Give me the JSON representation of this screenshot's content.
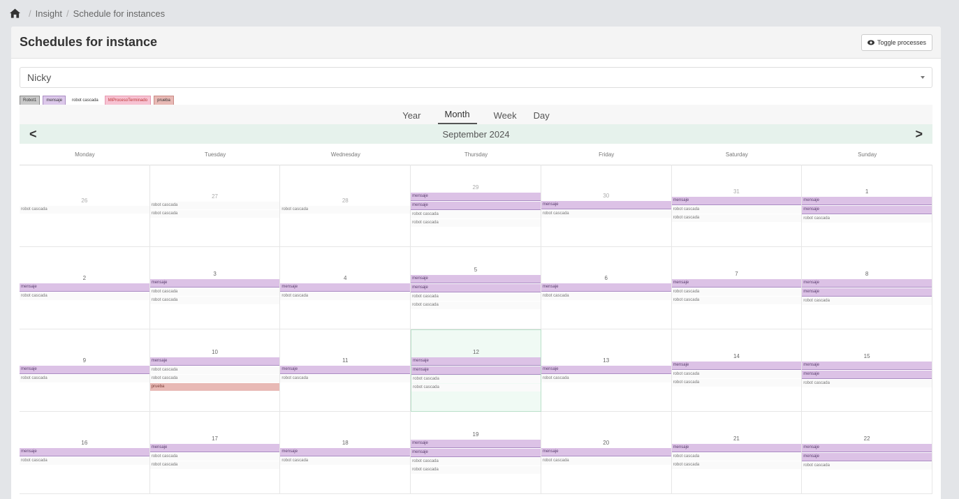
{
  "breadcrumb": {
    "items": [
      "Insight",
      "Schedule for instances"
    ],
    "separator": "/"
  },
  "panel": {
    "title": "Schedules for instance",
    "toggle_label": "Toggle processes"
  },
  "select": {
    "value": "Nicky"
  },
  "legend": [
    "Robot1",
    "mensaje",
    "robot cascada",
    "MiProcesoTerminado",
    "prueba"
  ],
  "views": [
    "Year",
    "Month",
    "Week",
    "Day"
  ],
  "active_view": "Month",
  "month_label": "September 2024",
  "nav": {
    "prev": "<",
    "next": ">"
  },
  "weekdays": [
    "Monday",
    "Tuesday",
    "Wednesday",
    "Thursday",
    "Friday",
    "Saturday",
    "Sunday"
  ],
  "days": [
    {
      "num": "26",
      "current": false,
      "events": [
        "robot cascada"
      ]
    },
    {
      "num": "27",
      "current": false,
      "events": [
        "robot cascada",
        "robot cascada"
      ]
    },
    {
      "num": "28",
      "current": false,
      "events": [
        "robot cascada"
      ]
    },
    {
      "num": "29",
      "current": false,
      "events": [
        "mensaje",
        "mensaje",
        "robot cascada",
        "robot cascada"
      ]
    },
    {
      "num": "30",
      "current": false,
      "events": [
        "mensaje",
        "robot cascada"
      ]
    },
    {
      "num": "31",
      "current": false,
      "events": [
        "mensaje",
        "robot cascada",
        "robot cascada"
      ]
    },
    {
      "num": "1",
      "current": true,
      "events": [
        "mensaje",
        "mensaje",
        "robot cascada"
      ]
    },
    {
      "num": "2",
      "current": true,
      "events": [
        "mensaje",
        "robot cascada"
      ]
    },
    {
      "num": "3",
      "current": true,
      "events": [
        "mensaje",
        "robot cascada",
        "robot cascada"
      ]
    },
    {
      "num": "4",
      "current": true,
      "events": [
        "mensaje",
        "robot cascada"
      ]
    },
    {
      "num": "5",
      "current": true,
      "events": [
        "mensaje",
        "mensaje",
        "robot cascada",
        "robot cascada"
      ]
    },
    {
      "num": "6",
      "current": true,
      "events": [
        "mensaje",
        "robot cascada"
      ]
    },
    {
      "num": "7",
      "current": true,
      "events": [
        "mensaje",
        "robot cascada",
        "robot cascada"
      ]
    },
    {
      "num": "8",
      "current": true,
      "events": [
        "mensaje",
        "mensaje",
        "robot cascada"
      ]
    },
    {
      "num": "9",
      "current": true,
      "events": [
        "mensaje",
        "robot cascada"
      ]
    },
    {
      "num": "10",
      "current": true,
      "events": [
        "mensaje",
        "robot cascada",
        "robot cascada",
        "prueba"
      ]
    },
    {
      "num": "11",
      "current": true,
      "events": [
        "mensaje",
        "robot cascada"
      ]
    },
    {
      "num": "12",
      "current": true,
      "today": true,
      "events": [
        "mensaje",
        "mensaje",
        "robot cascada",
        "robot cascada"
      ]
    },
    {
      "num": "13",
      "current": true,
      "events": [
        "mensaje",
        "robot cascada"
      ]
    },
    {
      "num": "14",
      "current": true,
      "events": [
        "mensaje",
        "robot cascada",
        "robot cascada"
      ]
    },
    {
      "num": "15",
      "current": true,
      "events": [
        "mensaje",
        "mensaje",
        "robot cascada"
      ]
    },
    {
      "num": "16",
      "current": true,
      "events": [
        "mensaje",
        "robot cascada"
      ]
    },
    {
      "num": "17",
      "current": true,
      "events": [
        "mensaje",
        "robot cascada",
        "robot cascada"
      ]
    },
    {
      "num": "18",
      "current": true,
      "events": [
        "mensaje",
        "robot cascada"
      ]
    },
    {
      "num": "19",
      "current": true,
      "events": [
        "mensaje",
        "mensaje",
        "robot cascada",
        "robot cascada"
      ]
    },
    {
      "num": "20",
      "current": true,
      "events": [
        "mensaje",
        "robot cascada"
      ]
    },
    {
      "num": "21",
      "current": true,
      "events": [
        "mensaje",
        "robot cascada",
        "robot cascada"
      ]
    },
    {
      "num": "22",
      "current": true,
      "events": [
        "mensaje",
        "mensaje",
        "robot cascada"
      ]
    }
  ]
}
